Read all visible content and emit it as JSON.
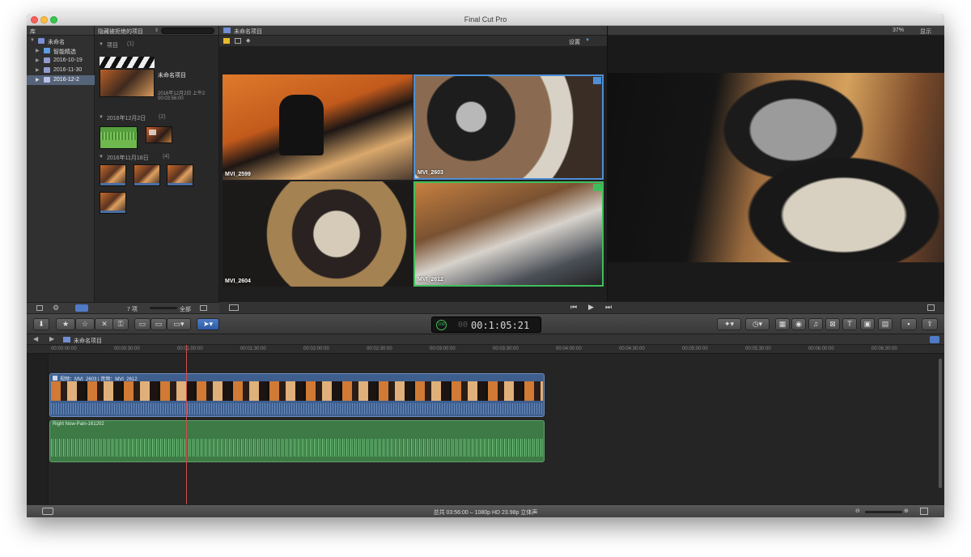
{
  "window": {
    "title": "Final Cut Pro"
  },
  "library": {
    "header": "库",
    "root": "未命名",
    "items": [
      "智能精选",
      "2016-10-19",
      "2016-11-30",
      "2016-12-2"
    ]
  },
  "browser": {
    "filter": "隐藏被拒绝的项目",
    "sections": [
      {
        "label": "项目",
        "count": "(1)"
      },
      {
        "label": "2016年12月2日",
        "count": "(2)"
      },
      {
        "label": "2016年11月18日",
        "count": "(4)"
      }
    ],
    "project": {
      "name": "未命名项目",
      "date": "2016年12月2日 上午2",
      "duration": "00:03:56:00"
    },
    "item_count": "7 项",
    "filter_all": "全部"
  },
  "angle_viewer": {
    "tab_title": "未命名项目",
    "settings": "设置",
    "angles": [
      "MVI_2599",
      "MVI_2603",
      "MVI_2604",
      "MVI_2612"
    ]
  },
  "viewer": {
    "zoom": "37%",
    "display": "显示"
  },
  "toolbar": {
    "timecode_small": "00",
    "timecode": "00:1:05:21",
    "tc_badge": "100"
  },
  "timeline": {
    "title": "未命名项目",
    "ruler": [
      "00:00:00:00",
      "00:00:30:00",
      "00:01:00:00",
      "00:01:30:00",
      "00:02:00:00",
      "00:02:30:00",
      "00:03:00:00",
      "00:03:30:00",
      "00:04:00:00",
      "00:04:30:00",
      "00:05:00:00",
      "00:05:30:00",
      "00:06:00:00",
      "00:06:30:00"
    ],
    "video_clip": "视频：MVI_2603 | 音频：MVI_2612",
    "audio_clip": "Right Now-Pain-161202"
  },
  "status": {
    "summary": "总共 03:56:00 – 1080p HD 23.98p 立体声"
  },
  "colors": {
    "accent": "#4f7bc6",
    "selected_angle": "#4d8fd6",
    "audio_angle": "#3fbf5a",
    "video_track": "#3e5f8e",
    "audio_track": "#3d7a46"
  }
}
